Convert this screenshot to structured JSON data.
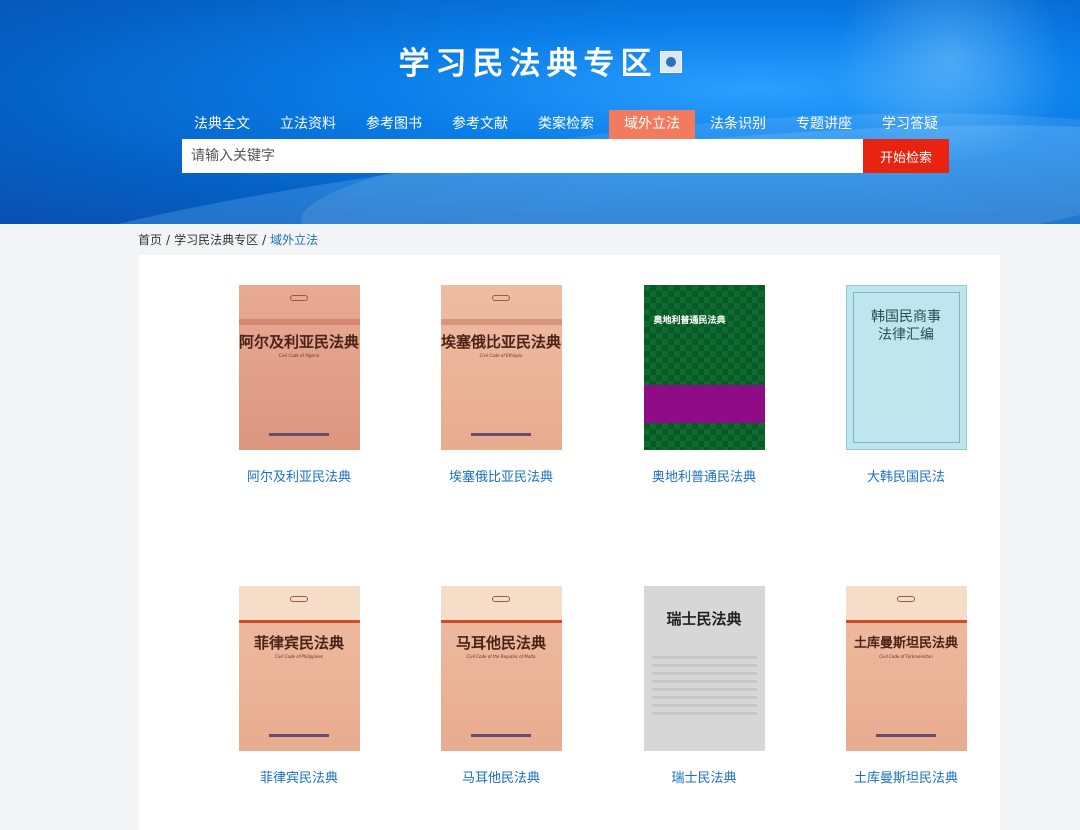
{
  "header": {
    "title": "学习民法典专区"
  },
  "nav": {
    "items": [
      {
        "label": "法典全文",
        "active": false
      },
      {
        "label": "立法资料",
        "active": false
      },
      {
        "label": "参考图书",
        "active": false
      },
      {
        "label": "参考文献",
        "active": false
      },
      {
        "label": "类案检索",
        "active": false
      },
      {
        "label": "域外立法",
        "active": true
      },
      {
        "label": "法条识别",
        "active": false
      },
      {
        "label": "专题讲座",
        "active": false
      },
      {
        "label": "学习答疑",
        "active": false
      }
    ]
  },
  "search": {
    "placeholder": "请输入关键字",
    "button_label": "开始检索"
  },
  "breadcrumb": {
    "home": "首页",
    "section": "学习民法典专区",
    "current": "域外立法",
    "separator": "/"
  },
  "books": [
    {
      "title": "阿尔及利亚民法典",
      "cover_text": "阿尔及利亚民法典",
      "cover_en": "Civil Code of Algeria",
      "cover_style": "pink"
    },
    {
      "title": "埃塞俄比亚民法典",
      "cover_text": "埃塞俄比亚民法典",
      "cover_en": "Civil Code of Ethiopia",
      "cover_style": "peach"
    },
    {
      "title": "奥地利普通民法典",
      "cover_text": "奥地利普通民法典",
      "cover_en": "",
      "cover_style": "checker"
    },
    {
      "title": "大韩民国民法",
      "cover_text": "韩国民商事法律汇编",
      "cover_en": "",
      "cover_style": "teal"
    },
    {
      "title": "菲律宾民法典",
      "cover_text": "菲律宾民法典",
      "cover_en": "Civil Code of Philippines",
      "cover_style": "peach-top"
    },
    {
      "title": "马耳他民法典",
      "cover_text": "马耳他民法典",
      "cover_en": "Civil Code of the Republic of Malta",
      "cover_style": "peach-top"
    },
    {
      "title": "瑞士民法典",
      "cover_text": "瑞士民法典",
      "cover_en": "",
      "cover_style": "gray"
    },
    {
      "title": "土库曼斯坦民法典",
      "cover_text": "土库曼斯坦民法典",
      "cover_en": "Civil Code of Turkmenistan",
      "cover_style": "peach-top"
    }
  ],
  "colors": {
    "accent_nav": "#f27a5e",
    "search_button": "#e8230f",
    "link": "#1a6fc2"
  }
}
